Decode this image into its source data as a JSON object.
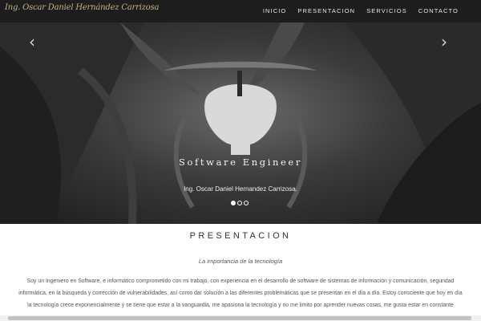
{
  "navbar": {
    "brand": "Ing. Oscar Daniel Hernández Carrizosa",
    "items": [
      {
        "label": "INICIO"
      },
      {
        "label": "PRESENTACION"
      },
      {
        "label": "SERVICIOS"
      },
      {
        "label": "CONTACTO"
      }
    ]
  },
  "carousel": {
    "prev_icon": "chevron-left-icon",
    "next_icon": "chevron-right-icon",
    "prev_glyph": "‹",
    "next_glyph": "›",
    "slide_title": "Software Engineer",
    "slide_caption": "Ing. Oscar Daniel Hernandez Carrizosa.",
    "indicator_count": 3,
    "active_indicator": 1
  },
  "presentation": {
    "title": "PRESENTACION",
    "subtitle": "La importancia de la tecnología",
    "paragraph": "Soy un Ingeniero en Software, e informático comprometido con mi trabajo, con experiencia en el desarrollo de software de sistemas de información y comunicación, seguridad informática, en la búsqueda y corrección de vulnerabilidades, así como dar solución a las diferentes problemáticas que se presentan en el día a día. Estoy consciente que hoy en día la tecnología crece exponencialmente y se tiene que estar a la vanguardia, me apasiona la tecnología y no me limito por aprender nuevas cosas, me gusta estar en constante"
  },
  "colors": {
    "navbar_bg": "#1d1d1d",
    "brand": "#c9b27a",
    "nav_text": "#e6e6e6",
    "body_text": "#555555"
  }
}
